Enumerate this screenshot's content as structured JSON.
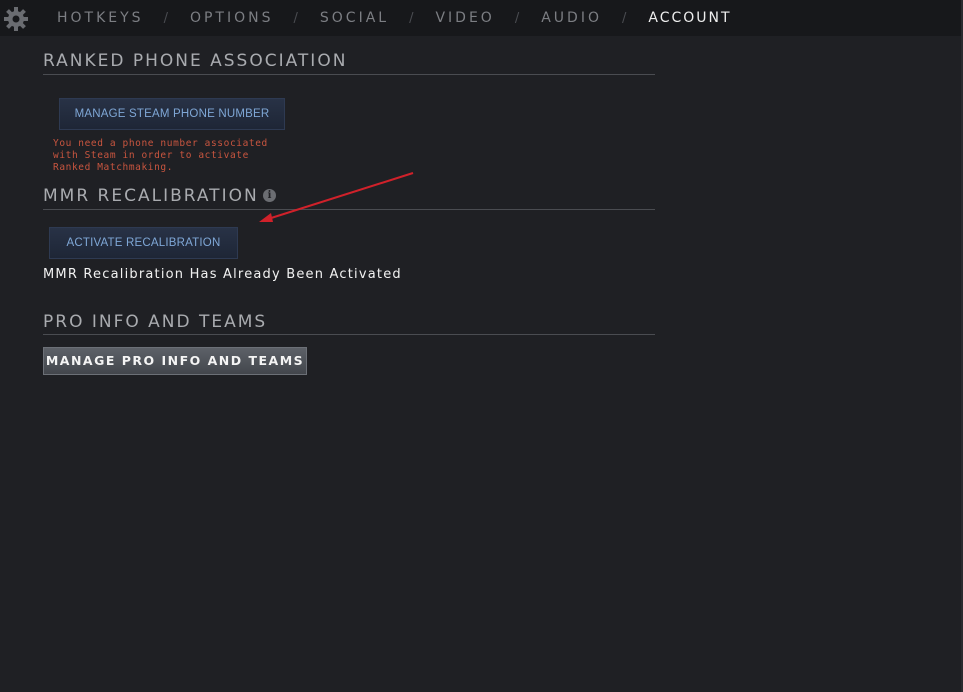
{
  "nav": {
    "tabs": [
      {
        "label": "HOTKEYS"
      },
      {
        "label": "OPTIONS"
      },
      {
        "label": "SOCIAL"
      },
      {
        "label": "VIDEO"
      },
      {
        "label": "AUDIO"
      },
      {
        "label": "ACCOUNT"
      }
    ],
    "separator": "/",
    "active": "ACCOUNT"
  },
  "phone": {
    "title": "RANKED PHONE ASSOCIATION",
    "button_label": "MANAGE STEAM PHONE NUMBER",
    "warning_line1": "You need a phone number associated",
    "warning_line2": "with Steam in order to activate",
    "warning_line3": "Ranked Matchmaking."
  },
  "mmr": {
    "title": "MMR RECALIBRATION",
    "info_icon": "i",
    "button_label": "ACTIVATE RECALIBRATION",
    "status": "MMR Recalibration Has Already Been Activated"
  },
  "pro": {
    "title": "PRO INFO AND TEAMS",
    "button_label": "MANAGE PRO INFO AND TEAMS"
  },
  "colors": {
    "background": "#1f2024",
    "topbar": "#17181b",
    "warning": "#c8553f",
    "annotation_arrow": "#d0212a",
    "link_blue": "#7fa7d6"
  }
}
